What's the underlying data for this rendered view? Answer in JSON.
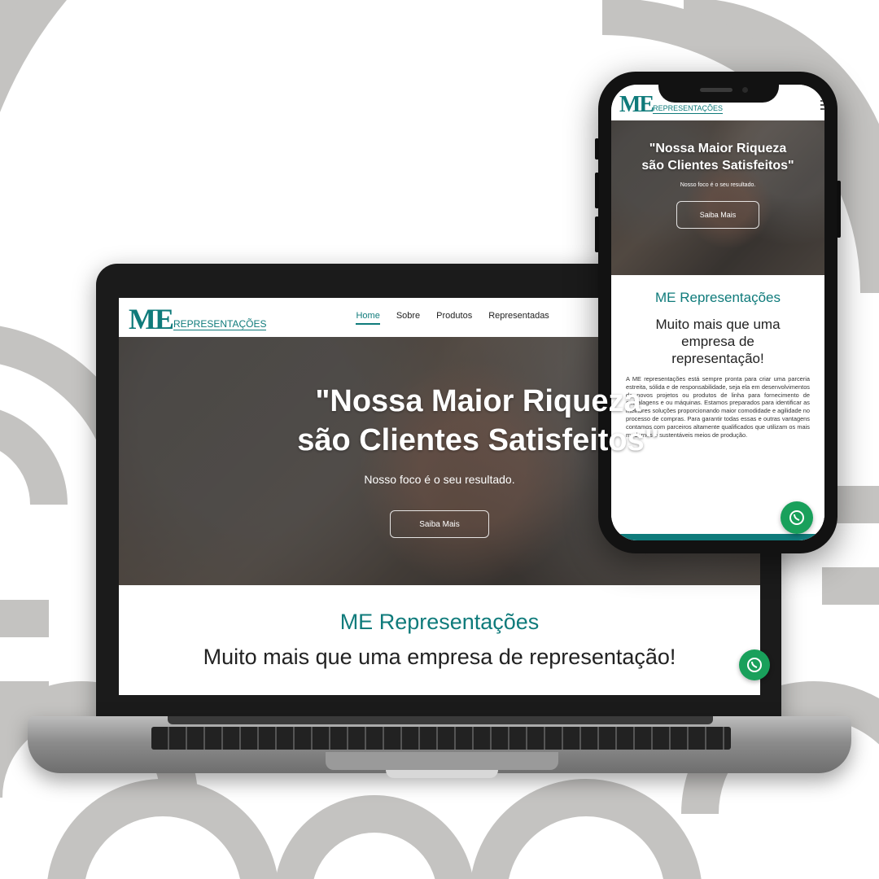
{
  "brand": {
    "logo_mark": "ME",
    "logo_word": "REPRESENTAÇÕES",
    "accent": "#0f7b7b",
    "whatsapp_color": "#19a05b"
  },
  "desktop": {
    "nav": [
      "Home",
      "Sobre",
      "Produtos",
      "Representadas"
    ],
    "hero": {
      "title_line1": "\"Nossa Maior Riqueza",
      "title_line2": "são Clientes Satisfeitos\"",
      "subtitle": "Nosso foco é o seu resultado.",
      "button": "Saiba Mais"
    },
    "section": {
      "title": "ME Representações",
      "heading": "Muito mais que uma empresa de representação!"
    }
  },
  "mobile": {
    "hero": {
      "title_line1": "\"Nossa Maior Riqueza",
      "title_line2": "são Clientes Satisfeitos\"",
      "subtitle": "Nosso foco é o seu resultado.",
      "button": "Saiba Mais"
    },
    "section": {
      "title": "ME Representações",
      "heading_line1": "Muito mais que uma",
      "heading_line2": "empresa de",
      "heading_line3": "representação!",
      "body": "A ME representações está sempre pronta para criar uma parceria estreita, sólida e de responsabilidade, seja ela em desenvolvimentos de novos projetos ou produtos de linha para fornecimento de embalagens e ou máquinas. Estamos preparados para identificar as melhores soluções proporcionando maior comodidade e agilidade no processo de compras. Para garantir todas essas e outras vantagens contamos com parceiros altamente qualificados que utilizam os mais modernos e sustentáveis meios de produção."
    },
    "menu_icon": "hamburger-icon"
  }
}
